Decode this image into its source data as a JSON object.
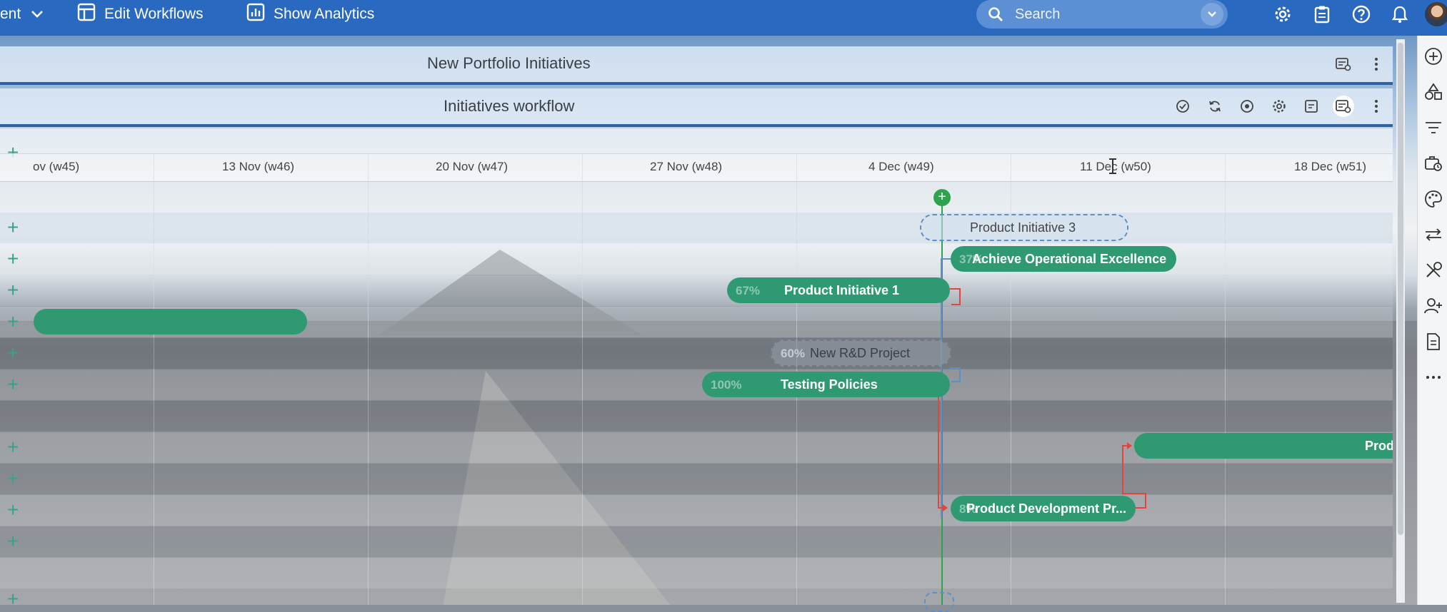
{
  "topbar": {
    "partial_item": "ent",
    "edit_workflows": "Edit Workflows",
    "show_analytics": "Show Analytics",
    "search_placeholder": "Search"
  },
  "panels": {
    "portfolio_title": "New Portfolio Initiatives",
    "workflow_title": "Initiatives workflow"
  },
  "timeline": {
    "weeks": [
      "ov (w45)",
      "13 Nov (w46)",
      "20 Nov (w47)",
      "27 Nov (w48)",
      "4 Dec (w49)",
      "11 Dec (w50)",
      "18 Dec (w51)"
    ],
    "bars": {
      "product_initiative_3": {
        "label": "Product Initiative 3"
      },
      "achieve_ops": {
        "label": "Achieve Operational Excellence",
        "pct": "37%"
      },
      "product_initiative_1": {
        "label": "Product Initiative 1",
        "pct": "67%"
      },
      "new_rd": {
        "label": "New R&D Project",
        "pct": "60%"
      },
      "testing_policies": {
        "label": "Testing Policies",
        "pct": "100%"
      },
      "prod_partial": {
        "label": "Prod"
      },
      "product_dev": {
        "label": "Product Development Pr...",
        "pct": "8%"
      }
    },
    "plus_symbol": "+"
  },
  "colors": {
    "topbar": "#2a69c0",
    "bar_green": "#2f9a72",
    "today_line": "#2ea34e",
    "dependency_red": "#e0463c",
    "dependency_blue": "#5d8fc8"
  },
  "icons": {
    "topbar": [
      "chevron-down-icon",
      "table-icon",
      "analytics-icon",
      "search-icon",
      "gear-icon",
      "clipboard-icon",
      "help-icon",
      "bell-icon"
    ],
    "sidebar": [
      "add-circle-icon",
      "shapes-icon",
      "filter-icon",
      "briefcase-clock-icon",
      "palette-icon",
      "swap-icon",
      "tools-icon",
      "add-user-icon",
      "document-icon",
      "more-icon"
    ]
  }
}
